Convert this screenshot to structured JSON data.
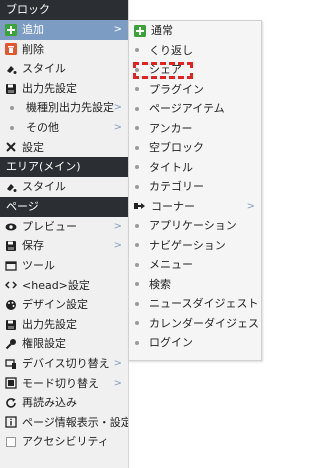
{
  "menu": {
    "sections": [
      {
        "header": "ブロック",
        "items": [
          {
            "label": "追加",
            "icon": "plus-icon",
            "arrow": ">",
            "highlighted": true
          },
          {
            "label": "削除",
            "icon": "trash-icon",
            "arrow": ""
          },
          {
            "label": "スタイル",
            "icon": "style-drop-icon",
            "arrow": ""
          },
          {
            "label": "出力先設定",
            "icon": "floppy-icon",
            "arrow": ""
          },
          {
            "label": "機種別出力先設定",
            "icon": "bullet-icon",
            "arrow": ">"
          },
          {
            "label": "その他",
            "icon": "bullet-icon",
            "arrow": ">"
          },
          {
            "label": "設定",
            "icon": "wrench-icon",
            "arrow": ""
          }
        ]
      },
      {
        "header": "エリア(メイン)",
        "items": [
          {
            "label": "スタイル",
            "icon": "style-drop-icon",
            "arrow": ""
          }
        ]
      },
      {
        "header": "ページ",
        "items": [
          {
            "label": "プレビュー",
            "icon": "eye-icon",
            "arrow": ">"
          },
          {
            "label": "保存",
            "icon": "floppy-icon",
            "arrow": ">"
          },
          {
            "label": "ツール",
            "icon": "tool-icon",
            "arrow": ""
          },
          {
            "label": "<head>設定",
            "icon": "code-icon",
            "arrow": ""
          },
          {
            "label": "デザイン設定",
            "icon": "palette-icon",
            "arrow": ""
          },
          {
            "label": "出力先設定",
            "icon": "floppy-icon",
            "arrow": ""
          },
          {
            "label": "権限設定",
            "icon": "key-icon",
            "arrow": ""
          },
          {
            "label": "デバイス切り替え",
            "icon": "device-icon",
            "arrow": ">"
          },
          {
            "label": "モード切り替え",
            "icon": "mode-icon",
            "arrow": ">"
          },
          {
            "label": "再読み込み",
            "icon": "reload-icon",
            "arrow": ""
          },
          {
            "label": "ページ情報表示・設定",
            "icon": "info-icon",
            "arrow": ""
          },
          {
            "label": "アクセシビリティ",
            "icon": "checkbox-icon",
            "arrow": ""
          }
        ]
      }
    ]
  },
  "submenu": {
    "items": [
      {
        "label": "通常",
        "icon": "plus-icon",
        "arrow": ""
      },
      {
        "label": "くり返し",
        "icon": "bullet-icon",
        "arrow": ""
      },
      {
        "label": "シェア",
        "icon": "bullet-icon",
        "arrow": "",
        "selected": true
      },
      {
        "label": "プラグイン",
        "icon": "bullet-icon",
        "arrow": ""
      },
      {
        "label": "ページアイテム",
        "icon": "bullet-icon",
        "arrow": ""
      },
      {
        "label": "アンカー",
        "icon": "bullet-icon",
        "arrow": ""
      },
      {
        "label": "空ブロック",
        "icon": "bullet-icon",
        "arrow": ""
      },
      {
        "label": "タイトル",
        "icon": "bullet-icon",
        "arrow": ""
      },
      {
        "label": "カテゴリー",
        "icon": "bullet-icon",
        "arrow": ""
      },
      {
        "label": "コーナー",
        "icon": "corner-icon",
        "arrow": ">"
      },
      {
        "label": "アプリケーション",
        "icon": "bullet-icon",
        "arrow": ""
      },
      {
        "label": "ナビゲーション",
        "icon": "bullet-icon",
        "arrow": ""
      },
      {
        "label": "メニュー",
        "icon": "bullet-icon",
        "arrow": ""
      },
      {
        "label": "検索",
        "icon": "bullet-icon",
        "arrow": ""
      },
      {
        "label": "ニュースダイジェスト",
        "icon": "bullet-icon",
        "arrow": ""
      },
      {
        "label": "カレンダーダイジェスト",
        "icon": "bullet-icon",
        "arrow": ""
      },
      {
        "label": "ログイン",
        "icon": "bullet-icon",
        "arrow": ""
      }
    ]
  },
  "colors": {
    "header_bg": "#2b2f33",
    "highlight_bg": "#7c9cc4",
    "plus_green": "#3aa33a",
    "selection_dash": "#e52222"
  }
}
